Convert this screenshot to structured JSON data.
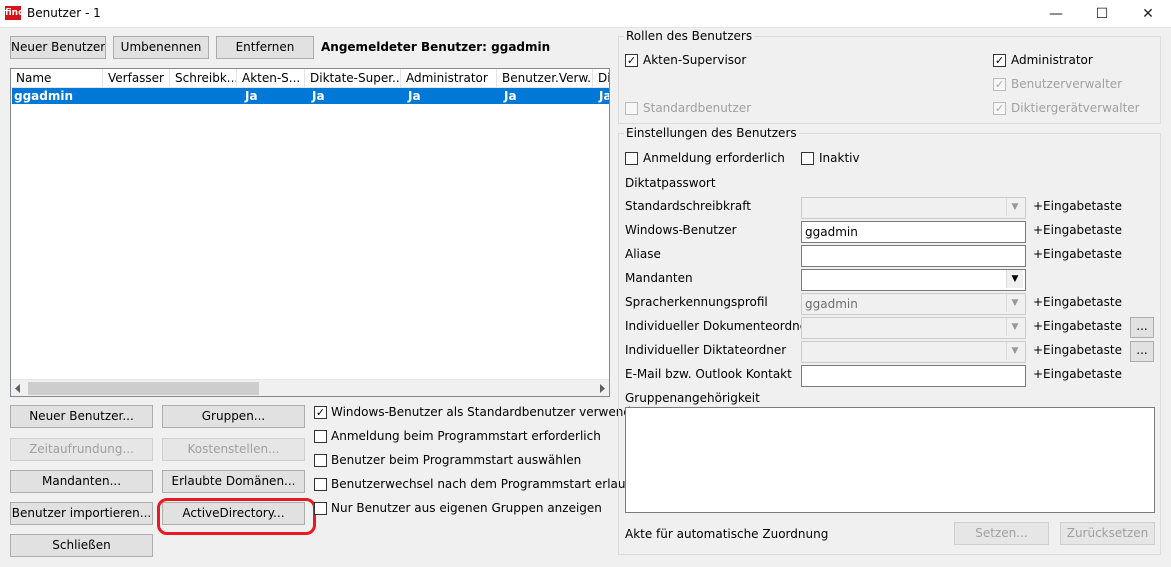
{
  "window": {
    "title": "Benutzer - 1",
    "app_icon_text": "find",
    "minimize": "—",
    "maximize": "☐",
    "close": "✕"
  },
  "top_buttons": {
    "new_user": "Neuer Benutzer",
    "rename": "Umbenennen",
    "remove": "Entfernen"
  },
  "logged_in": "Angemeldeter Benutzer: ggadmin",
  "user_list": {
    "columns": [
      "Name",
      "Verfasser",
      "Schreibk...",
      "Akten-S...",
      "Diktate-Super...",
      "Administrator",
      "Benutzer.Verw.",
      "Di"
    ],
    "rows": [
      {
        "cells": [
          "ggadmin",
          "",
          "",
          "Ja",
          "Ja",
          "Ja",
          "Ja",
          "Ja"
        ],
        "selected": true
      }
    ]
  },
  "bottom_buttons": {
    "new_user_dialog": "Neuer Benutzer...",
    "groups": "Gruppen...",
    "time_rounding": "Zeitaufrundung...",
    "cost_centers": "Kostenstellen...",
    "clients": "Mandanten...",
    "allowed_domains": "Erlaubte Domänen...",
    "import_users": "Benutzer importieren...",
    "active_directory": "ActiveDirectory...",
    "close": "Schließen"
  },
  "options": [
    {
      "label": "Windows-Benutzer als Standardbenutzer verwenden",
      "checked": true
    },
    {
      "label": "Anmeldung beim Programmstart erforderlich",
      "checked": false
    },
    {
      "label": "Benutzer beim Programmstart auswählen",
      "checked": false
    },
    {
      "label": "Benutzerwechsel nach dem Programmstart erlaubt",
      "checked": false
    },
    {
      "label": "Nur Benutzer aus eigenen Gruppen anzeigen",
      "checked": false
    }
  ],
  "roles": {
    "title": "Rollen des Benutzers",
    "items": [
      {
        "label": "Akten-Supervisor",
        "checked": true,
        "enabled": true
      },
      {
        "label": "Administrator",
        "checked": true,
        "enabled": true
      },
      {
        "label": "Benutzerverwalter",
        "checked": true,
        "enabled": false
      },
      {
        "label": "Standardbenutzer",
        "checked": false,
        "enabled": false
      },
      {
        "label": "Diktiergerätverwalter",
        "checked": true,
        "enabled": false
      }
    ]
  },
  "settings": {
    "title": "Einstellungen des Benutzers",
    "login_required": {
      "label": "Anmeldung erforderlich",
      "checked": false
    },
    "inactive": {
      "label": "Inaktiv",
      "checked": false
    },
    "dictation_password": "Diktatpasswort",
    "fields": [
      {
        "label": "Standardschreibkraft",
        "value": "",
        "suffix": "+Eingabetaste"
      },
      {
        "label": "Windows-Benutzer",
        "value": "ggadmin",
        "suffix": "+Eingabetaste"
      },
      {
        "label": "Aliase",
        "value": "",
        "suffix": "+Eingabetaste"
      },
      {
        "label": "Mandanten",
        "value": "",
        "suffix": ""
      },
      {
        "label": "Spracherkennungsprofil",
        "value": "ggadmin",
        "suffix": "+Eingabetaste"
      },
      {
        "label": "Individueller Dokumenteordner",
        "value": "",
        "suffix": "+Eingabetaste",
        "browse": "..."
      },
      {
        "label": "Individueller Diktateordner",
        "value": "",
        "suffix": "+Eingabetaste",
        "browse": "..."
      },
      {
        "label": "E-Mail bzw. Outlook Kontakt",
        "value": "",
        "suffix": "+Eingabetaste"
      }
    ],
    "group_membership": "Gruppenangehörigkeit",
    "auto_assign": "Akte für automatische Zuordnung",
    "set_button": "Setzen...",
    "reset_button": "Zurücksetzen"
  },
  "dropdown_glyph": "▼"
}
